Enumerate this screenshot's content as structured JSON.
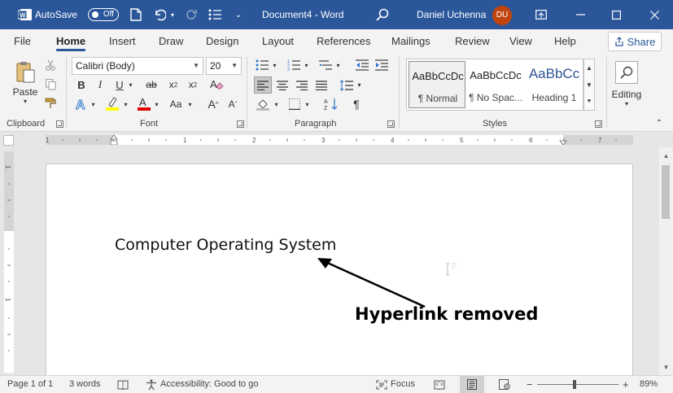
{
  "titlebar": {
    "autosave_label": "AutoSave",
    "autosave_state": "Off",
    "document_title": "Document4 - Word",
    "user_name": "Daniel Uchenna",
    "user_initials": "DU",
    "accent_color": "#2b579a",
    "avatar_color": "#c1440e"
  },
  "tabs": [
    "File",
    "Home",
    "Insert",
    "Draw",
    "Design",
    "Layout",
    "References",
    "Mailings",
    "Review",
    "View",
    "Help"
  ],
  "active_tab": "Home",
  "share_label": "Share",
  "ribbon": {
    "clipboard": {
      "paste_label": "Paste",
      "group_label": "Clipboard"
    },
    "font": {
      "font_name": "Calibri (Body)",
      "font_size": "20",
      "group_label": "Font"
    },
    "paragraph": {
      "group_label": "Paragraph"
    },
    "styles": {
      "group_label": "Styles",
      "items": [
        {
          "sample": "AaBbCcDc",
          "name": "¶ Normal"
        },
        {
          "sample": "AaBbCcDc",
          "name": "¶ No Spac..."
        },
        {
          "sample": "AaBbCc",
          "name": "Heading 1"
        }
      ]
    },
    "editing": {
      "label": "Editing"
    }
  },
  "document": {
    "body_text": "Computer Operating System",
    "annotation_text": "Hyperlink removed"
  },
  "statusbar": {
    "page": "Page 1 of 1",
    "words": "3 words",
    "accessibility": "Accessibility: Good to go",
    "focus": "Focus",
    "zoom": "89%"
  }
}
